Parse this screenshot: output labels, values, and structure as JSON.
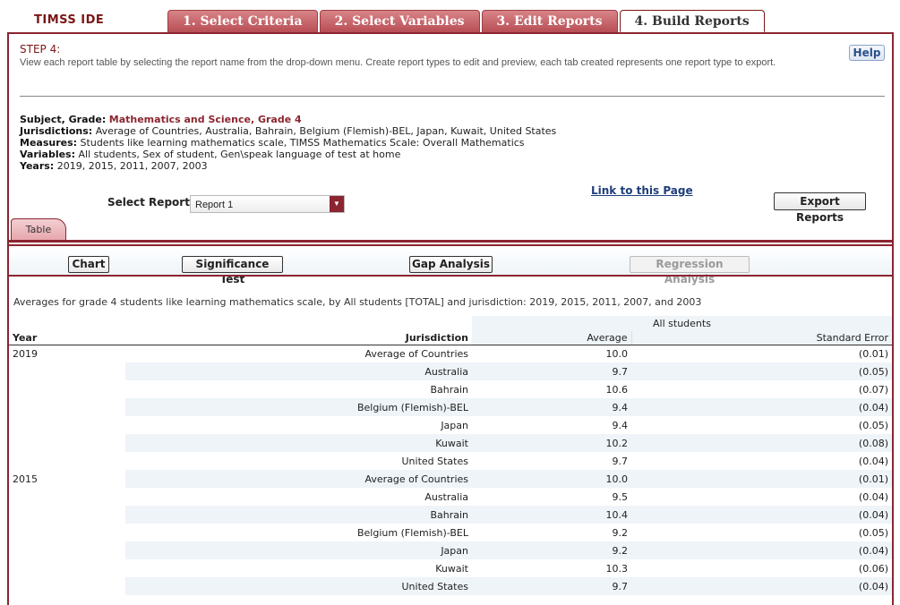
{
  "app": {
    "logo": "TIMSS IDE"
  },
  "tabs": [
    {
      "label": "1. Select Criteria",
      "active": false
    },
    {
      "label": "2. Select Variables",
      "active": false
    },
    {
      "label": "3. Edit Reports",
      "active": false
    },
    {
      "label": "4. Build Reports",
      "active": true
    }
  ],
  "step": {
    "title": "STEP 4:",
    "description": "View each report table by selecting the report name from the drop-down menu. Create report types to edit and preview, each tab created represents one report type to export.",
    "help_label": "Help"
  },
  "meta": {
    "subject_label": "Subject, Grade:",
    "subject_value": "Mathematics and Science, Grade 4",
    "jurisdictions_label": "Jurisdictions:",
    "jurisdictions_value": "Average of Countries, Australia, Bahrain, Belgium (Flemish)-BEL, Japan, Kuwait, United States",
    "measures_label": "Measures:",
    "measures_value": "Students like learning mathematics scale, TIMSS Mathematics Scale: Overall Mathematics",
    "variables_label": "Variables:",
    "variables_value": "All students, Sex of student, Gen\\speak language of test at home",
    "years_label": "Years:",
    "years_value": "2019, 2015, 2011, 2007, 2003"
  },
  "report_select": {
    "label": "Select Report:",
    "value": "Report 1"
  },
  "link_label": "Link to this Page",
  "export_label": "Export Reports",
  "subtab_label": "Table",
  "toolbar": {
    "chart": "Chart",
    "significance": "Significance Test",
    "gap": "Gap Analysis",
    "regression": "Regression Analysis"
  },
  "table": {
    "caption": "Averages for grade 4 students like learning mathematics scale, by All students [TOTAL] and jurisdiction: 2019, 2015, 2011, 2007, and 2003",
    "group_header": "All students",
    "col_year": "Year",
    "col_jurisdiction": "Jurisdiction",
    "col_average": "Average",
    "col_se": "Standard Error",
    "rows": [
      {
        "year": "2019",
        "jurisdiction": "Average of Countries",
        "average": "10.0",
        "se": "(0.01)"
      },
      {
        "year": "",
        "jurisdiction": "Australia",
        "average": "9.7",
        "se": "(0.05)"
      },
      {
        "year": "",
        "jurisdiction": "Bahrain",
        "average": "10.6",
        "se": "(0.07)"
      },
      {
        "year": "",
        "jurisdiction": "Belgium (Flemish)-BEL",
        "average": "9.4",
        "se": "(0.04)"
      },
      {
        "year": "",
        "jurisdiction": "Japan",
        "average": "9.4",
        "se": "(0.05)"
      },
      {
        "year": "",
        "jurisdiction": "Kuwait",
        "average": "10.2",
        "se": "(0.08)"
      },
      {
        "year": "",
        "jurisdiction": "United States",
        "average": "9.7",
        "se": "(0.04)"
      },
      {
        "year": "2015",
        "jurisdiction": "Average of Countries",
        "average": "10.0",
        "se": "(0.01)"
      },
      {
        "year": "",
        "jurisdiction": "Australia",
        "average": "9.5",
        "se": "(0.04)"
      },
      {
        "year": "",
        "jurisdiction": "Bahrain",
        "average": "10.4",
        "se": "(0.04)"
      },
      {
        "year": "",
        "jurisdiction": "Belgium (Flemish)-BEL",
        "average": "9.2",
        "se": "(0.05)"
      },
      {
        "year": "",
        "jurisdiction": "Japan",
        "average": "9.2",
        "se": "(0.04)"
      },
      {
        "year": "",
        "jurisdiction": "Kuwait",
        "average": "10.3",
        "se": "(0.06)"
      },
      {
        "year": "",
        "jurisdiction": "United States",
        "average": "9.7",
        "se": "(0.04)"
      }
    ]
  }
}
